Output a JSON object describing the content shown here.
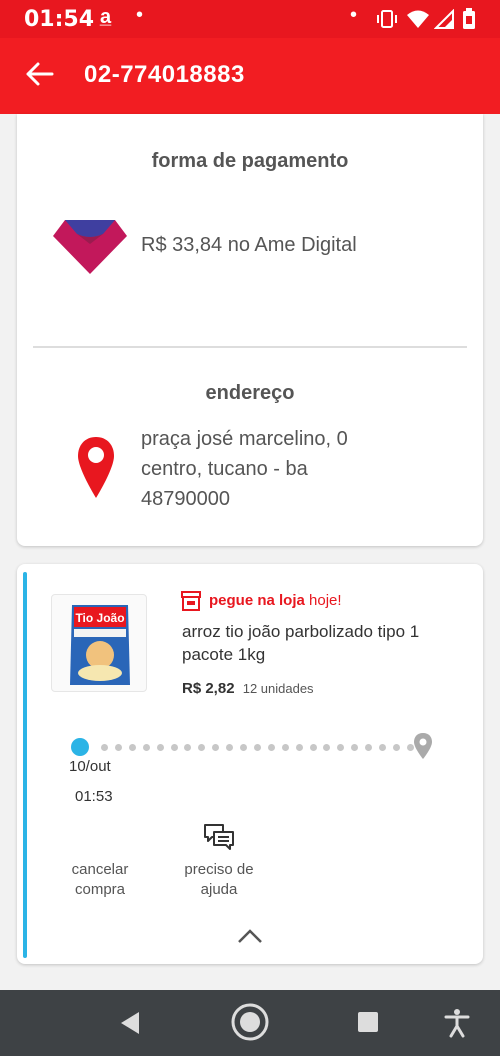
{
  "status_bar": {
    "time": "01:54",
    "icons": [
      "ame-notification-icon",
      "dot-icon",
      "dot-icon",
      "vibrate-icon",
      "wifi-icon",
      "signal-icon",
      "battery-icon"
    ]
  },
  "app_bar": {
    "back_icon": "arrow-left-icon",
    "title": "02-774018883"
  },
  "payment": {
    "heading": "forma de pagamento",
    "text": "R$ 33,84 no Ame Digital",
    "icon": "ame-logo-icon"
  },
  "address": {
    "heading": "endereço",
    "lines": [
      "praça josé marcelino, 0",
      "centro, tucano - ba",
      "48790000"
    ],
    "icon": "location-pin-icon"
  },
  "item": {
    "pickup_label": "pegue na loja",
    "pickup_when": "hoje!",
    "name": "arroz tio joão parbolizado tipo 1 pacote 1kg",
    "price": "R$ 2,82",
    "units": "12 unidades",
    "product_brand": "Tio João"
  },
  "tracking": {
    "date": "10/out",
    "time": "01:53",
    "progress_fraction": 0
  },
  "actions": {
    "cancel": [
      "cancelar",
      "compra"
    ],
    "help": [
      "preciso de",
      "ajuda"
    ]
  },
  "colors": {
    "brand_red": "#f21d22",
    "accent_blue": "#2bb4e6",
    "nav_bg": "#3e4245"
  }
}
